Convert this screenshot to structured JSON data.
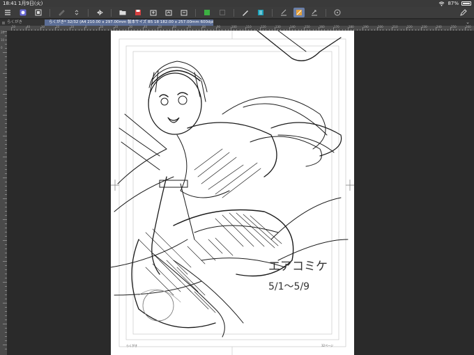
{
  "status": {
    "time": "18:41",
    "date": "1月9日(火)",
    "battery": "87%",
    "battery_level": 0.87
  },
  "toolbar": {
    "icons": [
      "menu-icon",
      "clip-studio-icon",
      "new-canvas-icon",
      "pen-disabled-icon",
      "stepper-icon",
      "flip-icon",
      "open-folder-icon",
      "save-icon",
      "export-icon",
      "export-alt-icon",
      "green-layer-icon",
      "disabled-icon",
      "color-picker-icon",
      "teal-panel-icon",
      "check-icon",
      "check-active-icon",
      "check-alt-icon",
      "help-icon"
    ]
  },
  "tabs": {
    "home_label": "らくがき",
    "active_label": "らくがき* 32/32 (A4 210.00 x 297.00mm 製本サイズ B5 18 182.00 x 257.00mm 600dpi 28.2%)"
  },
  "ruler": {
    "top_numbers": [
      "50",
      "40",
      "30",
      "20",
      "10",
      "0",
      "10",
      "20",
      "30",
      "40",
      "50",
      "60",
      "70",
      "80",
      "90",
      "100",
      "110",
      "120",
      "130",
      "140",
      "150",
      "160",
      "170",
      "180",
      "190",
      "200",
      "210",
      "220",
      "230",
      "240",
      "250",
      "260"
    ],
    "left_numbers": [
      "20",
      "10",
      "0"
    ]
  },
  "canvas": {
    "handwritten_text": [
      "エアコミケ",
      "5/1〜5/9"
    ],
    "footer_left": "らくがき",
    "footer_right": "32ページ"
  },
  "colors": {
    "accent": "#5c6e96",
    "active_tool": "#6a7fa8",
    "paper": "#ffffff",
    "workspace": "#2a2a2a"
  }
}
